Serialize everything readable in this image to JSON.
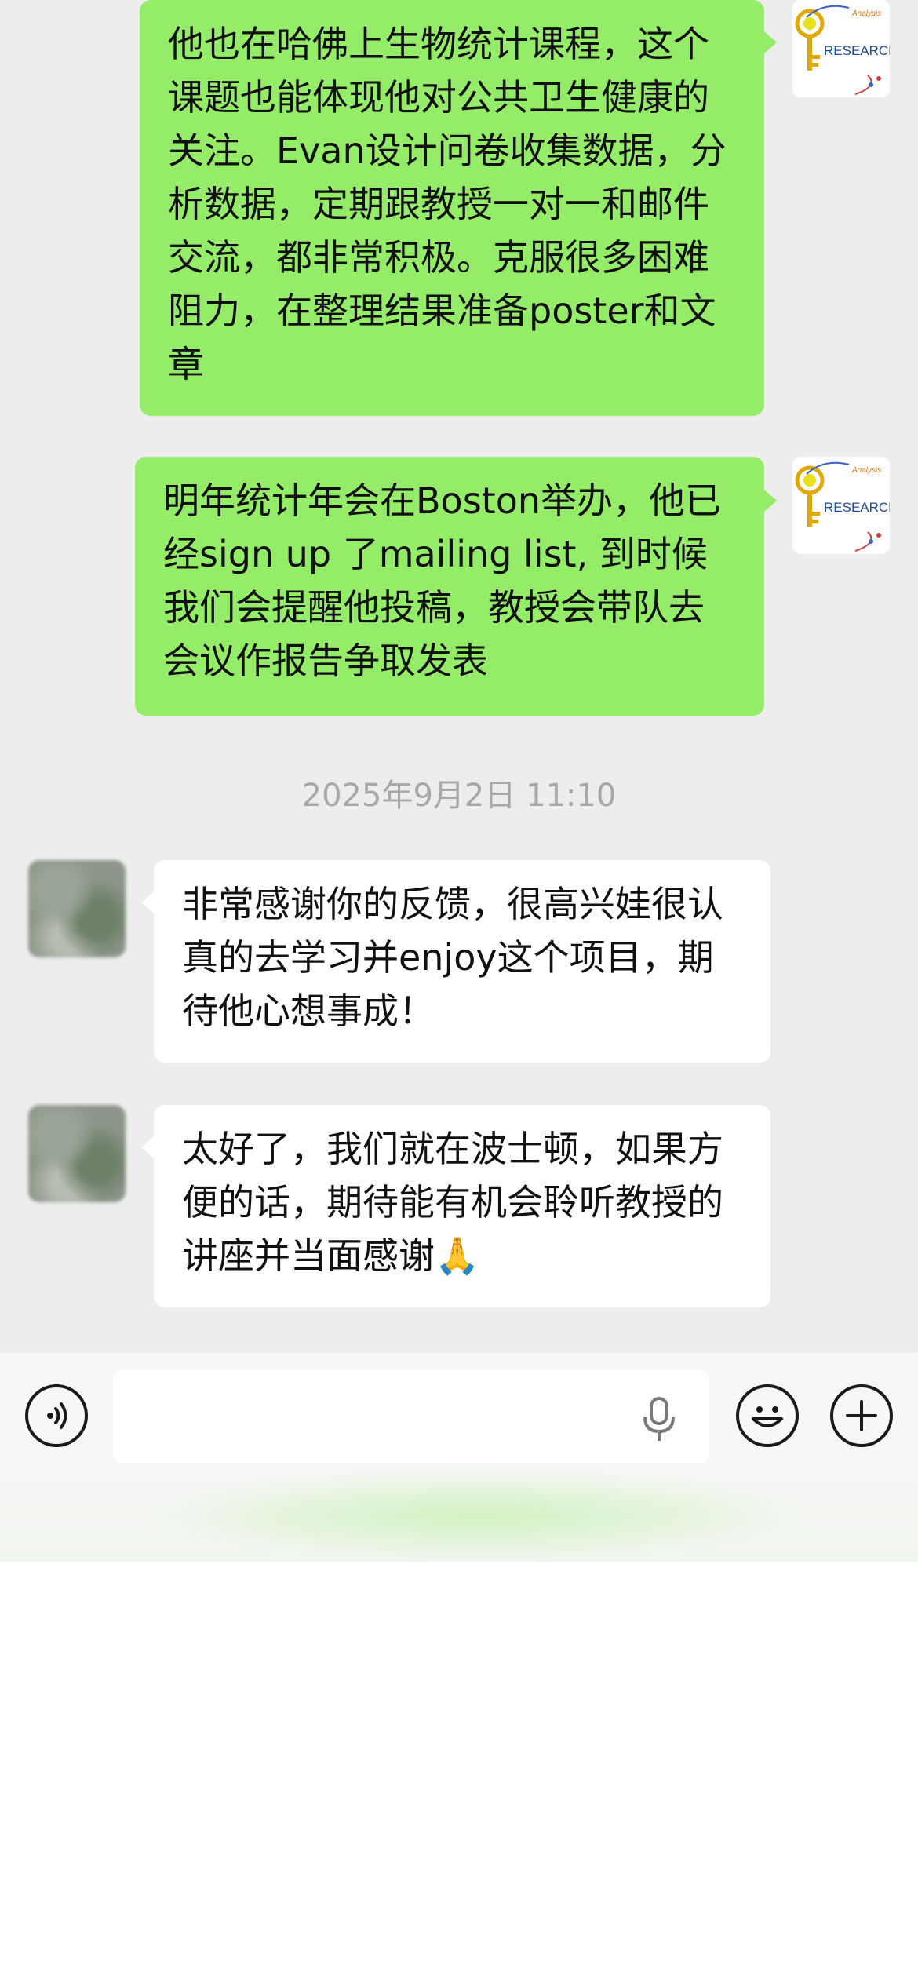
{
  "messages": [
    {
      "from": "self",
      "text": "他也在哈佛上生物统计课程，这个课题也能体现他对公共卫生健康的关注。Evan设计问卷收集数据，分析数据，定期跟教授一对一和邮件交流，都非常积极。克服很多困难阻力，在整理结果准备poster和文章",
      "avatar_text": "RESEARCH",
      "avatar_small": "Analysis"
    },
    {
      "from": "self",
      "text": "明年统计年会在Boston举办，他已经sign up 了mailing list, 到时候我们会提醒他投稿，教授会带队去会议作报告争取发表",
      "avatar_text": "RESEARCH",
      "avatar_small": "Analysis"
    },
    {
      "from": "other",
      "text": "非常感谢你的反馈，很高兴娃很认真的去学习并enjoy这个项目，期待他心想事成！"
    },
    {
      "from": "other",
      "text": "太好了，我们就在波士顿，如果方便的话，期待能有机会聆听教授的讲座并当面感谢🙏"
    }
  ],
  "timestamp": "2025年9月2日 11:10",
  "input": {
    "value": "",
    "voice_icon": "voice-icon",
    "mic_icon": "microphone-icon",
    "emoji_icon": "emoji-icon",
    "plus_icon": "plus-icon"
  },
  "colors": {
    "self_bubble": "#95ec69",
    "other_bubble": "#ffffff",
    "chat_background": "#ededed",
    "timestamp_text": "#a8a8a8"
  }
}
